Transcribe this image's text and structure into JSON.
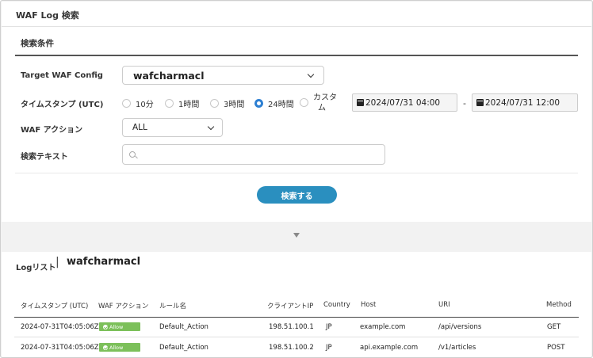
{
  "page": {
    "title": "WAF Log 検索"
  },
  "search": {
    "section_title": "検索条件",
    "config_label": "Target WAF Config",
    "config_value": "wafcharmacl",
    "timestamp_label": "タイムスタンプ (UTC)",
    "time_options": [
      "10分",
      "1時間",
      "3時間",
      "24時間",
      "カスタム"
    ],
    "time_selected": "24時間",
    "custom_line1": "カスタ",
    "custom_line2": "ム",
    "date_from": "2024/07/31 04:00",
    "date_separator": "-",
    "date_to": "2024/07/31 12:00",
    "action_label": "WAF アクション",
    "action_value": "ALL",
    "text_label": "検索テキスト",
    "text_value": "",
    "button_label": "検索する"
  },
  "log": {
    "label": "Logリスト",
    "separator": "|",
    "config": "wafcharmacl",
    "columns": [
      "タイムスタンプ (UTC)",
      "WAF アクション",
      "ルール名",
      "クライアントIP",
      "Country",
      "Host",
      "URI",
      "Method"
    ],
    "rows": [
      {
        "timestamp": "2024-07-31T04:05:06Z",
        "action": "Allow",
        "rule": "Default_Action",
        "ip": "198.51.100.1",
        "country": "JP",
        "host": "example.com",
        "uri": "/api/versions",
        "method": "GET"
      },
      {
        "timestamp": "2024-07-31T04:05:06Z",
        "action": "Allow",
        "rule": "Default_Action",
        "ip": "198.51.100.2",
        "country": "JP",
        "host": "api.example.com",
        "uri": "/v1/articles",
        "method": "POST"
      }
    ]
  },
  "colors": {
    "primary": "#2a8fbf",
    "radio_selected": "#2d7fd2",
    "allow_badge": "#7cc05a"
  },
  "icons": [
    "chevron-down-icon",
    "calendar-icon",
    "search-icon",
    "collapse-arrow-icon",
    "check-circle-icon"
  ]
}
